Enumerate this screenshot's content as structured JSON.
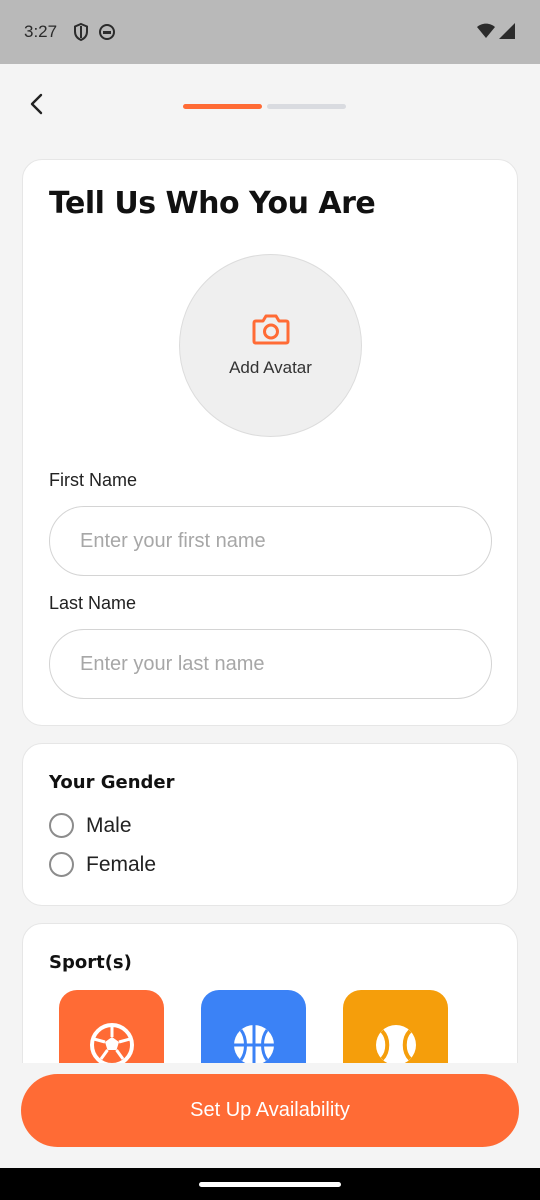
{
  "status_bar": {
    "time": "3:27"
  },
  "onboarding": {
    "step": 1,
    "total_steps": 2
  },
  "profile_card": {
    "title": "Tell Us Who You Are",
    "avatar_label": "Add Avatar",
    "first_name": {
      "label": "First Name",
      "placeholder": "Enter your first name",
      "value": ""
    },
    "last_name": {
      "label": "Last Name",
      "placeholder": "Enter your last name",
      "value": ""
    }
  },
  "gender_card": {
    "title": "Your Gender",
    "options": [
      {
        "label": "Male",
        "selected": false
      },
      {
        "label": "Female",
        "selected": false
      }
    ]
  },
  "sports_card": {
    "title": "Sport(s)",
    "tiles": [
      {
        "icon": "soccer-ball-icon",
        "color": "#ff6b35"
      },
      {
        "icon": "basketball-icon",
        "color": "#3b82f6"
      },
      {
        "icon": "tennis-ball-icon",
        "color": "#f59e0b"
      }
    ]
  },
  "cta": {
    "label": "Set Up Availability"
  },
  "colors": {
    "accent": "#ff6b35",
    "progress_inactive": "#d9dbe0",
    "background": "#f4f4f4"
  }
}
